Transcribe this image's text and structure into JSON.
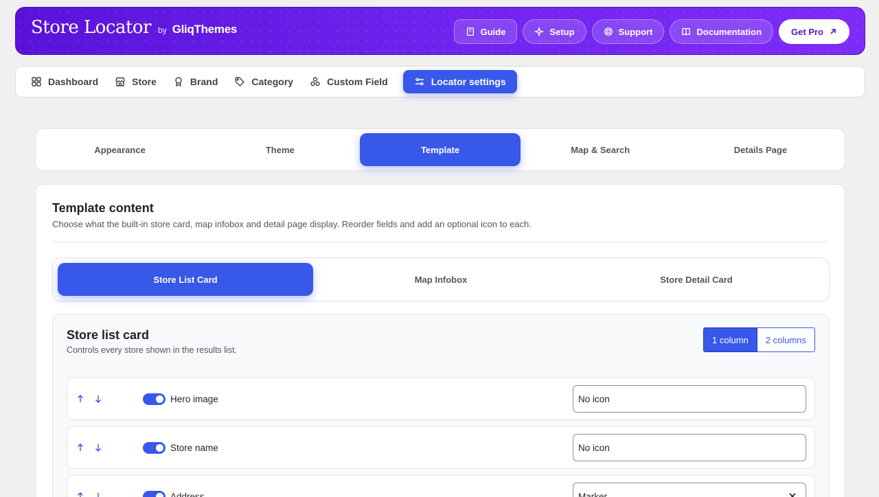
{
  "header": {
    "title": "Store Locator",
    "by": "by",
    "company": "GliqThemes",
    "actions": {
      "guide": "Guide",
      "setup": "Setup",
      "support": "Support",
      "documentation": "Documentation",
      "get_pro": "Get Pro"
    }
  },
  "nav": {
    "items": [
      {
        "label": "Dashboard",
        "icon": "grid-icon"
      },
      {
        "label": "Store",
        "icon": "storefront-icon"
      },
      {
        "label": "Brand",
        "icon": "award-icon"
      },
      {
        "label": "Category",
        "icon": "tag-icon"
      },
      {
        "label": "Custom Field",
        "icon": "cluster-icon"
      },
      {
        "label": "Locator settings",
        "icon": "sliders-icon",
        "active": true
      }
    ]
  },
  "subtabs": [
    "Appearance",
    "Theme",
    "Template",
    "Map & Search",
    "Details Page"
  ],
  "subtabs_active": "Template",
  "panel": {
    "title": "Template content",
    "description": "Choose what the built-in store card, map infobox and detail page display. Reorder fields and add an optional icon to each."
  },
  "segments": [
    "Store List Card",
    "Map Infobox",
    "Store Detail Card"
  ],
  "segments_active": "Store List Card",
  "card": {
    "title": "Store list card",
    "description": "Controls every store shown in the results list.",
    "columns": [
      "1 column",
      "2 columns"
    ],
    "columns_active": "1 column",
    "rows": [
      {
        "label": "Hero image",
        "enabled": true,
        "icon": "No icon"
      },
      {
        "label": "Store name",
        "enabled": true,
        "icon": "No icon"
      },
      {
        "label": "Address",
        "enabled": true,
        "icon": "Marker"
      }
    ]
  },
  "colors": {
    "brand_purple": "#6f24ee",
    "accent_blue": "#3858e9"
  }
}
